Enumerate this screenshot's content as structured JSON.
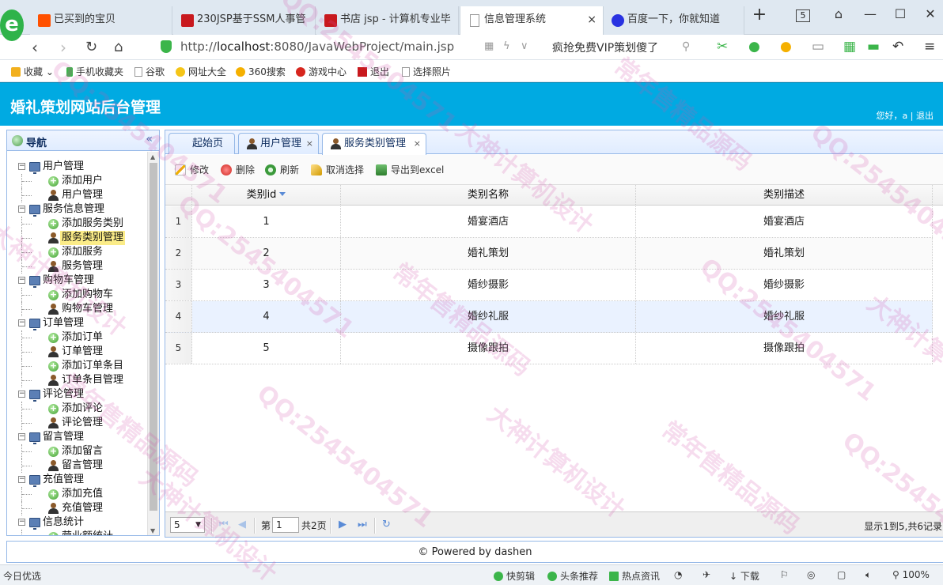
{
  "browser": {
    "logo_glyph": "e",
    "tabs": [
      {
        "label": "已买到的宝贝"
      },
      {
        "label": "230JSP基于SSM人事管"
      },
      {
        "label": "书店 jsp - 计算机专业毕"
      },
      {
        "label": "信息管理系统",
        "close": "×"
      },
      {
        "label": "百度一下，你就知道"
      }
    ],
    "new_tab": "+",
    "tab_count": "5",
    "window_controls": [
      "⌂",
      "—",
      "☐",
      "✕"
    ],
    "url_host": "http://",
    "url_bold": "localhost",
    "url_rest": ":8080/JavaWebProject/main.jsp",
    "promo_text": "疯抢免费VIP策划傻了",
    "bookmarks": [
      {
        "label": "收藏",
        "color": "#f2b01e"
      },
      {
        "label": "手机收藏夹",
        "color": "#3bb54a"
      },
      {
        "label": "谷歌",
        "color": "#ffffff"
      },
      {
        "label": "网址大全",
        "color": "#f5c518"
      },
      {
        "label": "360搜索",
        "color": "#f5b000"
      },
      {
        "label": "游戏中心",
        "color": "#d7261e"
      },
      {
        "label": "退出",
        "color": "#c8191e"
      },
      {
        "label": "选择照片",
        "color": "#ffffff"
      }
    ]
  },
  "header": {
    "title": "婚礼策划网站后台管理",
    "greeting": "您好，a",
    "separator": " | ",
    "logout": "退出"
  },
  "nav": {
    "title": "导航",
    "collapse": "«",
    "tree": [
      {
        "label": "用户管理",
        "type": "parent"
      },
      {
        "label": "添加用户",
        "type": "add"
      },
      {
        "label": "用户管理",
        "type": "user"
      },
      {
        "label": "服务信息管理",
        "type": "parent"
      },
      {
        "label": "添加服务类别",
        "type": "add"
      },
      {
        "label": "服务类别管理",
        "type": "user",
        "selected": true
      },
      {
        "label": "添加服务",
        "type": "add"
      },
      {
        "label": "服务管理",
        "type": "user"
      },
      {
        "label": "购物车管理",
        "type": "parent"
      },
      {
        "label": "添加购物车",
        "type": "add"
      },
      {
        "label": "购物车管理",
        "type": "user"
      },
      {
        "label": "订单管理",
        "type": "parent"
      },
      {
        "label": "添加订单",
        "type": "add"
      },
      {
        "label": "订单管理",
        "type": "user"
      },
      {
        "label": "添加订单条目",
        "type": "add"
      },
      {
        "label": "订单条目管理",
        "type": "user"
      },
      {
        "label": "评论管理",
        "type": "parent"
      },
      {
        "label": "添加评论",
        "type": "add"
      },
      {
        "label": "评论管理",
        "type": "user"
      },
      {
        "label": "留言管理",
        "type": "parent"
      },
      {
        "label": "添加留言",
        "type": "add"
      },
      {
        "label": "留言管理",
        "type": "user"
      },
      {
        "label": "充值管理",
        "type": "parent"
      },
      {
        "label": "添加充值",
        "type": "add"
      },
      {
        "label": "充值管理",
        "type": "user"
      },
      {
        "label": "信息统计",
        "type": "parent"
      },
      {
        "label": "营业额统计",
        "type": "add"
      }
    ]
  },
  "main": {
    "tabs": [
      {
        "label": "起始页"
      },
      {
        "label": "用户管理",
        "close": "×"
      },
      {
        "label": "服务类别管理",
        "close": "×"
      }
    ],
    "toolbar": {
      "edit": "修改",
      "delete": "删除",
      "refresh": "刷新",
      "cancel_select": "取消选择",
      "export": "导出到excel"
    },
    "columns": [
      "类别id",
      "类别名称",
      "类别描述"
    ],
    "rows": [
      {
        "num": "1",
        "id": "1",
        "name": "婚宴酒店",
        "desc": "婚宴酒店"
      },
      {
        "num": "2",
        "id": "2",
        "name": "婚礼策划",
        "desc": "婚礼策划"
      },
      {
        "num": "3",
        "id": "3",
        "name": "婚纱摄影",
        "desc": "婚纱摄影"
      },
      {
        "num": "4",
        "id": "4",
        "name": "婚纱礼服",
        "desc": "婚纱礼服"
      },
      {
        "num": "5",
        "id": "5",
        "name": "摄像跟拍",
        "desc": "摄像跟拍"
      }
    ],
    "pager": {
      "page_size": "5",
      "page_prefix": "第",
      "page_value": "1",
      "page_total": "共2页",
      "info": "显示1到5,共6记录"
    }
  },
  "footer": {
    "text": "© Powered by dashen"
  },
  "statusbar": {
    "left": "今日优选",
    "items": [
      {
        "label": "快剪辑",
        "color": "#3bb54a"
      },
      {
        "label": "头条推荐",
        "color": "#3bb54a"
      },
      {
        "label": "热点资讯",
        "color": "#3bb54a"
      },
      {
        "label": "下载",
        "color": ""
      }
    ],
    "zoom": "100%"
  },
  "watermark": {
    "texts": [
      "大神计算机设计",
      "QQ:2545404571",
      "常年售精品源码"
    ],
    "color": "#d250aa"
  }
}
